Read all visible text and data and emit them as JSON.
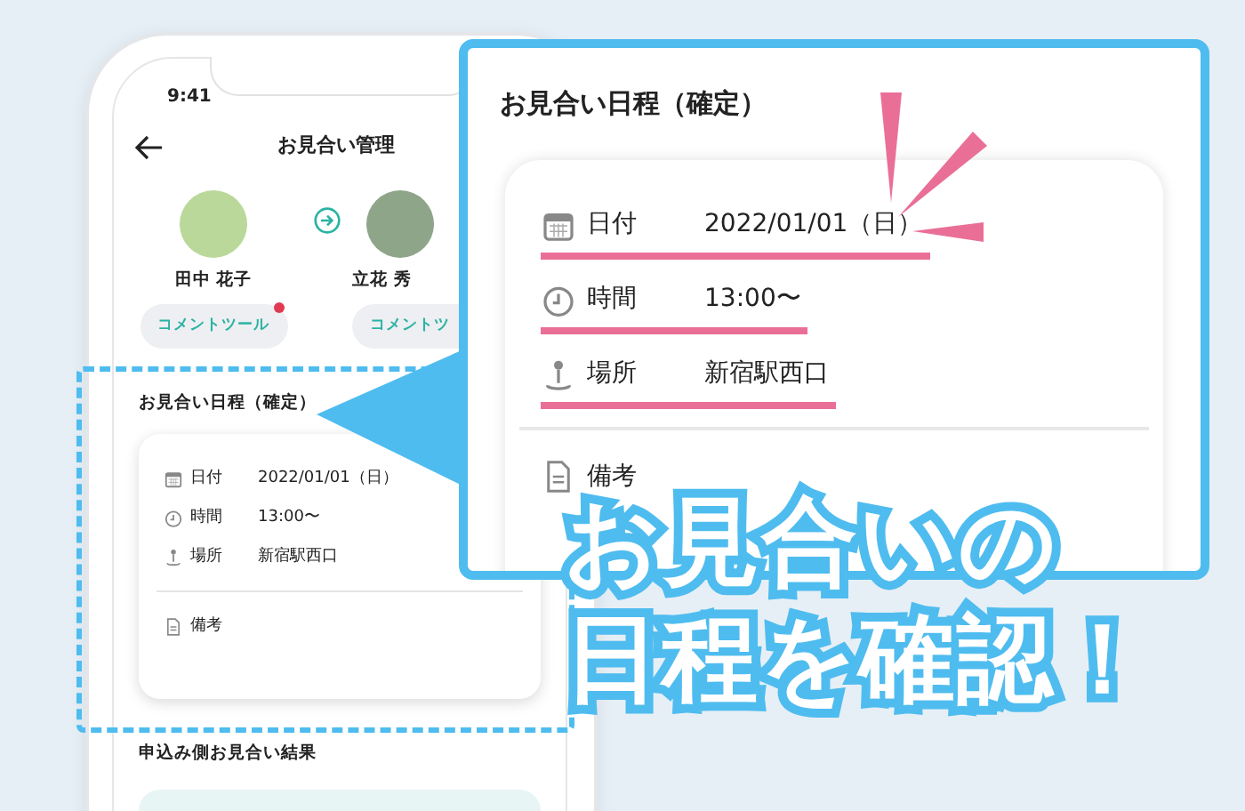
{
  "phone": {
    "status_time": "9:41",
    "title": "お見合い管理",
    "people": [
      {
        "name": "田中 花子",
        "button": "コメントツール",
        "notification": true
      },
      {
        "name": "立花 秀",
        "button": "コメントツ",
        "notification": false
      }
    ],
    "schedule": {
      "title": "お見合い日程（確定）",
      "rows": [
        {
          "kind": "date",
          "label": "日付",
          "value": "2022/01/01（日）"
        },
        {
          "kind": "time",
          "label": "時間",
          "value": "13:00〜"
        },
        {
          "kind": "place",
          "label": "場所",
          "value": "新宿駅西口"
        }
      ],
      "notes_label": "備考"
    },
    "result_title": "申込み側お見合い結果"
  },
  "callout": {
    "title": "お見合い日程（確定）",
    "rows": [
      {
        "kind": "date",
        "label": "日付",
        "value": "2022/01/01（日）",
        "underlined": true
      },
      {
        "kind": "time",
        "label": "時間",
        "value": "13:00〜",
        "underlined": true
      },
      {
        "kind": "place",
        "label": "場所",
        "value": "新宿駅西口",
        "underlined": true
      }
    ],
    "notes_label": "備考"
  },
  "headline": [
    "お見合いの",
    "日程を確認！"
  ]
}
